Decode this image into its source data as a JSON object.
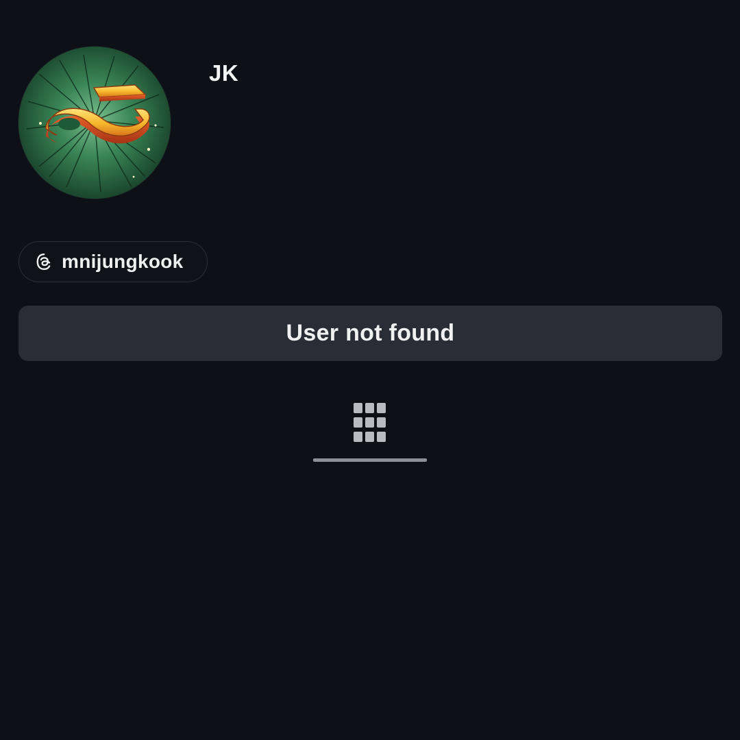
{
  "profile": {
    "display_name": "JK",
    "threads_handle": "mnijungkook",
    "avatar_icon": "infinity-logo-avatar"
  },
  "status": {
    "message": "User not found"
  },
  "tabs": {
    "active": "grid-icon"
  },
  "colors": {
    "background": "#0d1016",
    "status_bar": "#2a2d35",
    "chip_border": "#2b2f38",
    "text": "#f2f2f4",
    "tab_indicator": "#8e9097"
  }
}
